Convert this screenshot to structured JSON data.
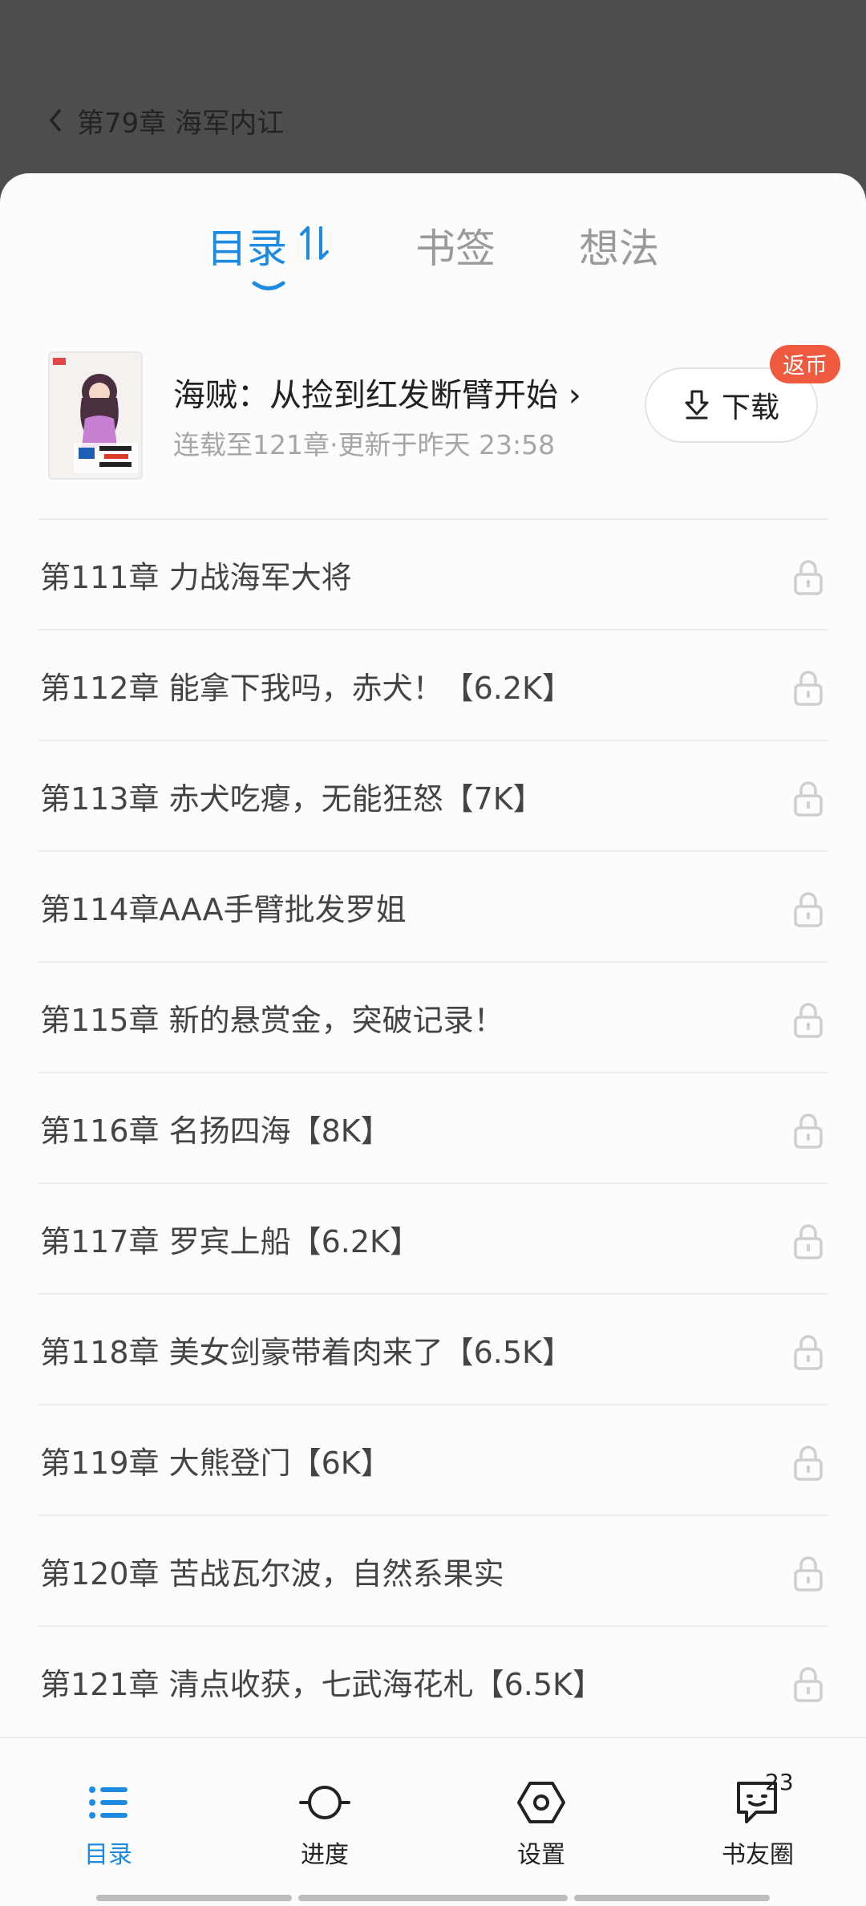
{
  "header": {
    "back_title": "第79章 海军内讧"
  },
  "tabs": [
    {
      "label": "目录",
      "active": true
    },
    {
      "label": "书签",
      "active": false
    },
    {
      "label": "想法",
      "active": false
    }
  ],
  "book": {
    "title": "海贼：从捡到红发断臂开始 ›",
    "meta": "连载至121章·更新于昨天 23:58",
    "download_label": "下载",
    "badge": "返币"
  },
  "chapters": [
    "第111章 力战海军大将",
    "第112章 能拿下我吗，赤犬！【6.2K】",
    "第113章 赤犬吃瘪，无能狂怒【7K】",
    "第114章AAA手臂批发罗姐",
    "第115章 新的悬赏金，突破记录！",
    "第116章 名扬四海【8K】",
    "第117章 罗宾上船【6.2K】",
    "第118章 美女剑豪带着肉来了【6.5K】",
    "第119章 大熊登门【6K】",
    "第120章 苦战瓦尔波，自然系果实",
    "第121章 清点收获，七武海花札【6.5K】"
  ],
  "bottom_nav": [
    {
      "label": "目录",
      "icon": "list-icon",
      "active": true
    },
    {
      "label": "进度",
      "icon": "progress-icon",
      "active": false
    },
    {
      "label": "设置",
      "icon": "settings-icon",
      "active": false
    },
    {
      "label": "书友圈",
      "icon": "chat-bubble-icon",
      "active": false,
      "count": "23"
    }
  ],
  "colors": {
    "accent": "#1e8be3",
    "badge": "#f05a3e",
    "lock": "#cfcfcf"
  }
}
